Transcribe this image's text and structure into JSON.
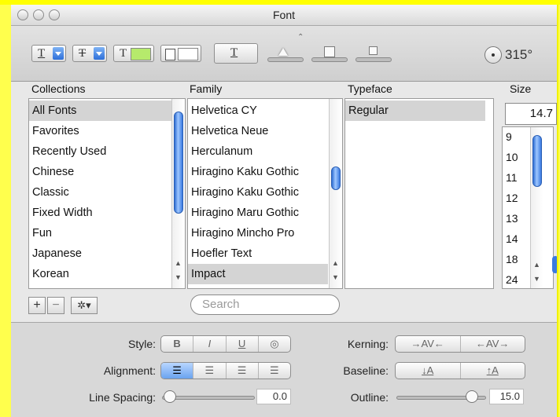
{
  "window": {
    "title": "Font"
  },
  "toolbar": {
    "angle": "315°",
    "text_glyph": "T"
  },
  "columns": {
    "collections_header": "Collections",
    "family_header": "Family",
    "typeface_header": "Typeface",
    "size_header": "Size"
  },
  "collections": [
    "All Fonts",
    "Favorites",
    "Recently Used",
    "Chinese",
    "Classic",
    "Fixed Width",
    "Fun",
    "Japanese",
    "Korean"
  ],
  "families": [
    "Helvetica CY",
    "Helvetica Neue",
    "Herculanum",
    "Hiragino Kaku Gothic",
    "Hiragino Kaku Gothic",
    "Hiragino Maru Gothic",
    "Hiragino Mincho Pro",
    "Hoefler Text",
    "Impact"
  ],
  "typefaces": [
    "Regular"
  ],
  "size": {
    "value": "14.7",
    "list": [
      "9",
      "10",
      "11",
      "12",
      "13",
      "14",
      "18",
      "24"
    ]
  },
  "search": {
    "placeholder": "Search"
  },
  "collection_buttons": {
    "add": "+",
    "remove": "−",
    "action": "✲▾"
  },
  "style": {
    "style_label": "Style:",
    "style_buttons": [
      "B",
      "I",
      "U",
      "◎"
    ],
    "alignment_label": "Alignment:",
    "kerning_label": "Kerning:",
    "kerning_buttons": [
      "→AV←",
      "←AV→"
    ],
    "baseline_label": "Baseline:",
    "baseline_buttons": [
      "↓A",
      "↑A"
    ],
    "line_spacing_label": "Line Spacing:",
    "line_spacing_value": "0.0",
    "outline_label": "Outline:",
    "outline_value": "15.0"
  },
  "colors": {
    "frame": "#ffff4d",
    "selection": "#d4d4d4",
    "scroll_thumb": "#3a7ae0"
  }
}
